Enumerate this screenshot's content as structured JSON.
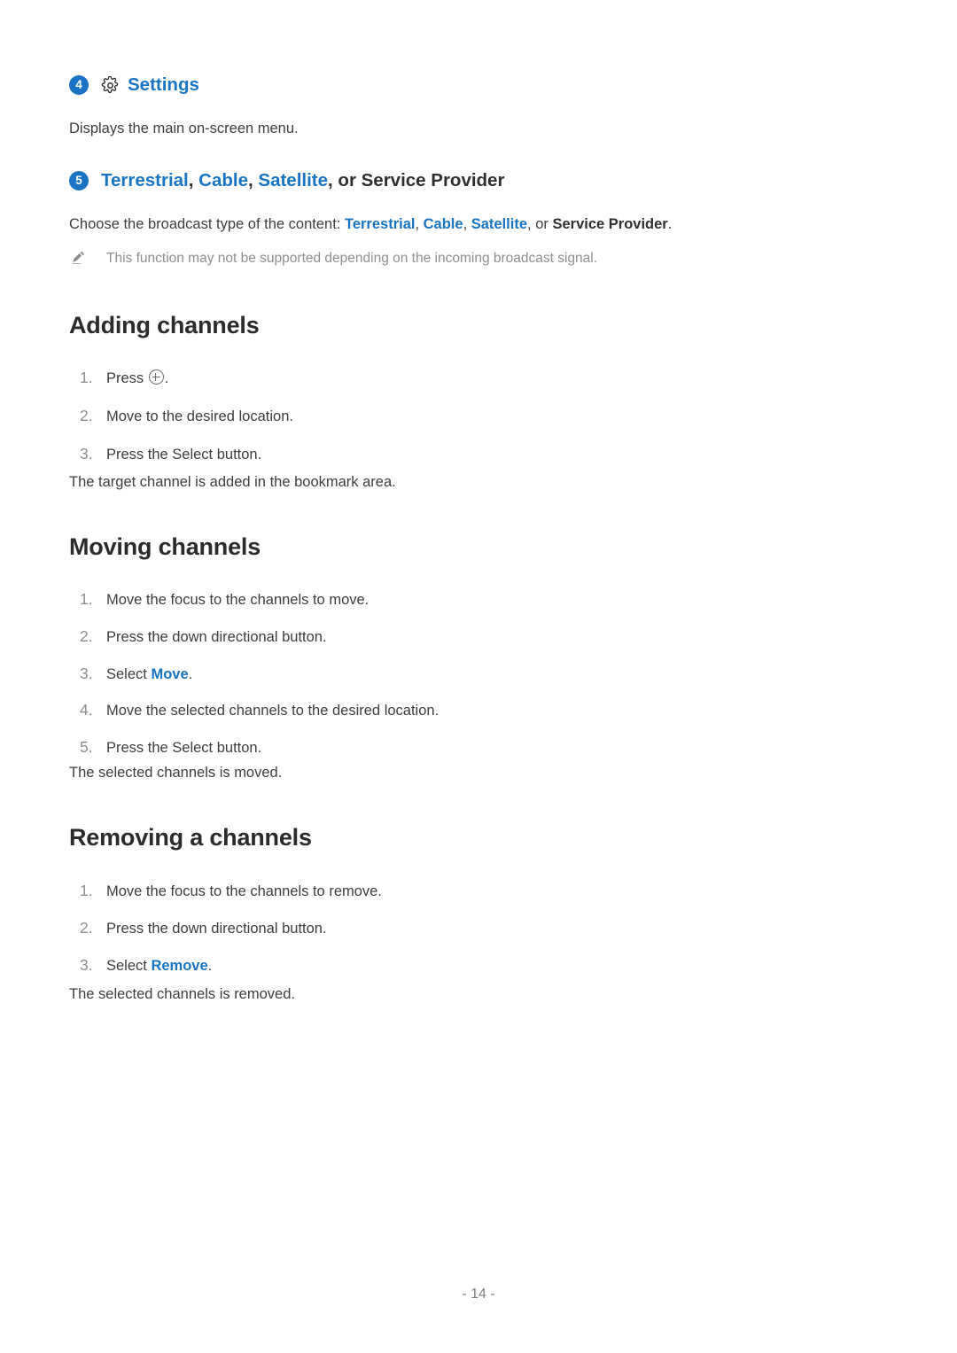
{
  "colors": {
    "accent_blue": "#1974c4",
    "body_text": "#3d3d3d",
    "heading_text": "#2b2b2b",
    "muted_gray": "#8f8f8f",
    "marker_gray": "#8d8d8d"
  },
  "items": {
    "settings": {
      "number": "4",
      "icon": "gear-icon",
      "label": "Settings",
      "description": "Displays the main on-screen menu."
    },
    "broadcast": {
      "number": "5",
      "title_parts": {
        "terrestrial": "Terrestrial",
        "sep1": ", ",
        "cable": "Cable",
        "sep2": ", ",
        "satellite": "Satellite",
        "tail": ", or Service Provider"
      },
      "description_lead": "Choose the broadcast type of the content: ",
      "description_terrestrial": "Terrestrial",
      "description_sep1": ", ",
      "description_cable": "Cable",
      "description_sep2": ", ",
      "description_satellite": "Satellite",
      "description_mid": ", or ",
      "description_provider": "Service Provider",
      "description_end": ".",
      "note_icon": "pencil-icon",
      "note": "This function may not be supported depending on the incoming broadcast signal."
    }
  },
  "sections": [
    {
      "heading": "Adding channels",
      "steps": [
        {
          "marker": "1.",
          "pre": "Press ",
          "icon": "circle-plus-icon",
          "post": "."
        },
        {
          "marker": "2.",
          "text": "Move to the desired location."
        },
        {
          "marker": "3.",
          "text": "Press the Select button."
        }
      ],
      "result": "The target channel is added in the bookmark area."
    },
    {
      "heading": "Moving channels",
      "steps": [
        {
          "marker": "1.",
          "text": "Move the focus to the channels to move."
        },
        {
          "marker": "2.",
          "text": "Press the down directional button."
        },
        {
          "marker": "3.",
          "pre": "Select ",
          "highlight": "Move",
          "post": "."
        },
        {
          "marker": "4.",
          "text": "Move the selected channels to the desired location."
        },
        {
          "marker": "5.",
          "text": "Press the Select button."
        }
      ],
      "result": "The selected channels is moved."
    },
    {
      "heading": "Removing a channels",
      "steps": [
        {
          "marker": "1.",
          "text": "Move the focus to the channels to remove."
        },
        {
          "marker": "2.",
          "text": "Press the down directional button."
        },
        {
          "marker": "3.",
          "pre": "Select ",
          "highlight": "Remove",
          "post": "."
        }
      ],
      "result": "The selected channels is removed."
    }
  ],
  "footer": {
    "page_label": "- 14 -"
  }
}
